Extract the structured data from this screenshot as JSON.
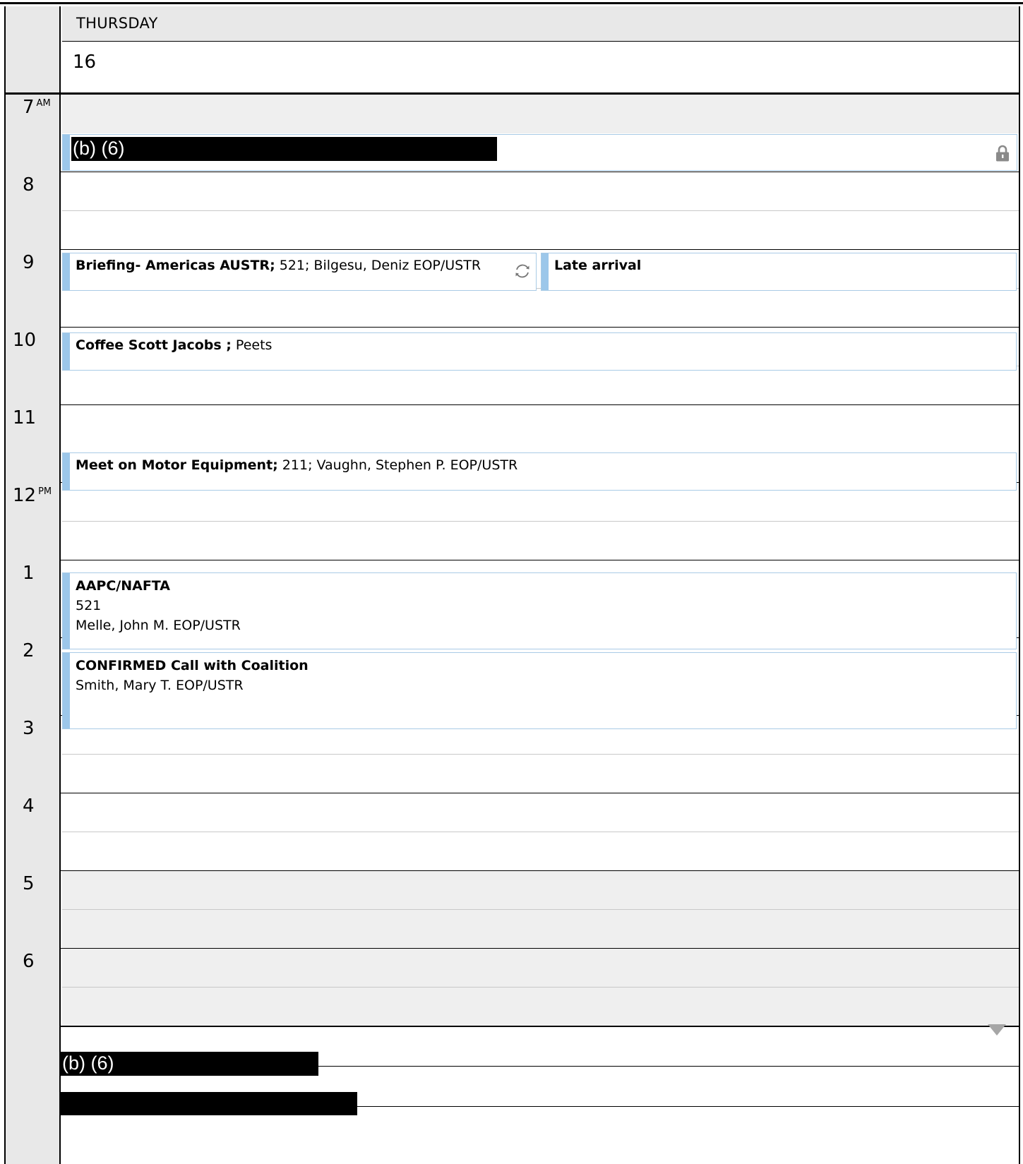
{
  "day": {
    "name": "THURSDAY",
    "date": "16"
  },
  "hours": [
    "7",
    "8",
    "9",
    "10",
    "11",
    "12",
    "1",
    "2",
    "3",
    "4",
    "5",
    "6"
  ],
  "meridiem": {
    "am": "AM",
    "pm": "PM"
  },
  "redactions": {
    "label": "(b) (6)"
  },
  "events": {
    "briefing": {
      "title": "Briefing- Americas AUSTR;",
      "detail": " 521; Bilgesu, Deniz EOP/USTR",
      "icon": "recurrence-icon"
    },
    "late_arrival": {
      "title": "Late arrival"
    },
    "coffee": {
      "title": "Coffee Scott Jacobs ;",
      "detail": " Peets"
    },
    "motor": {
      "title": "Meet on Motor Equipment;",
      "detail": " 211; Vaughn, Stephen P. EOP/USTR"
    },
    "aapc": {
      "title": "AAPC/NAFTA",
      "line2": "521",
      "line3": "Melle, John M. EOP/USTR"
    },
    "coalition": {
      "title": "CONFIRMED  Call with Coalition",
      "line2": "Smith, Mary T. EOP/USTR"
    },
    "private_icon": "lock-icon"
  },
  "colors": {
    "event_accent": "#9cc7ea",
    "event_border": "#a9cbe6",
    "time_column": "#e8e8e8",
    "after_hours": "#efefef"
  }
}
